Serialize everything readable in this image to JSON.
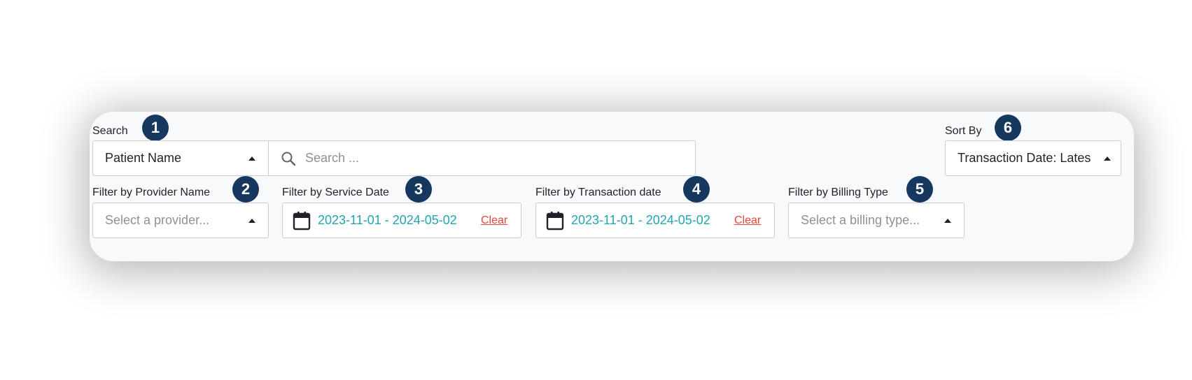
{
  "search": {
    "label": "Search",
    "badge": "1",
    "field_selected": "Patient Name",
    "placeholder": "Search ...",
    "icon": "search-icon"
  },
  "sort": {
    "label": "Sort By",
    "badge": "6",
    "selected": "Transaction Date: Lates"
  },
  "provider_filter": {
    "label": "Filter by Provider Name",
    "badge": "2",
    "placeholder": "Select a provider..."
  },
  "service_date_filter": {
    "label": "Filter by Service Date",
    "badge": "3",
    "range": "2023-11-01 - 2024-05-02",
    "clear_label": "Clear",
    "icon": "calendar-icon"
  },
  "transaction_date_filter": {
    "label": "Filter by Transaction date",
    "badge": "4",
    "range": "2023-11-01 - 2024-05-02",
    "clear_label": "Clear",
    "icon": "calendar-icon"
  },
  "billing_filter": {
    "label": "Filter by Billing Type",
    "badge": "5",
    "placeholder": "Select a billing type..."
  },
  "colors": {
    "badge": "#16385f",
    "date_text": "#22a4b5",
    "clear_link": "#e0473c"
  }
}
